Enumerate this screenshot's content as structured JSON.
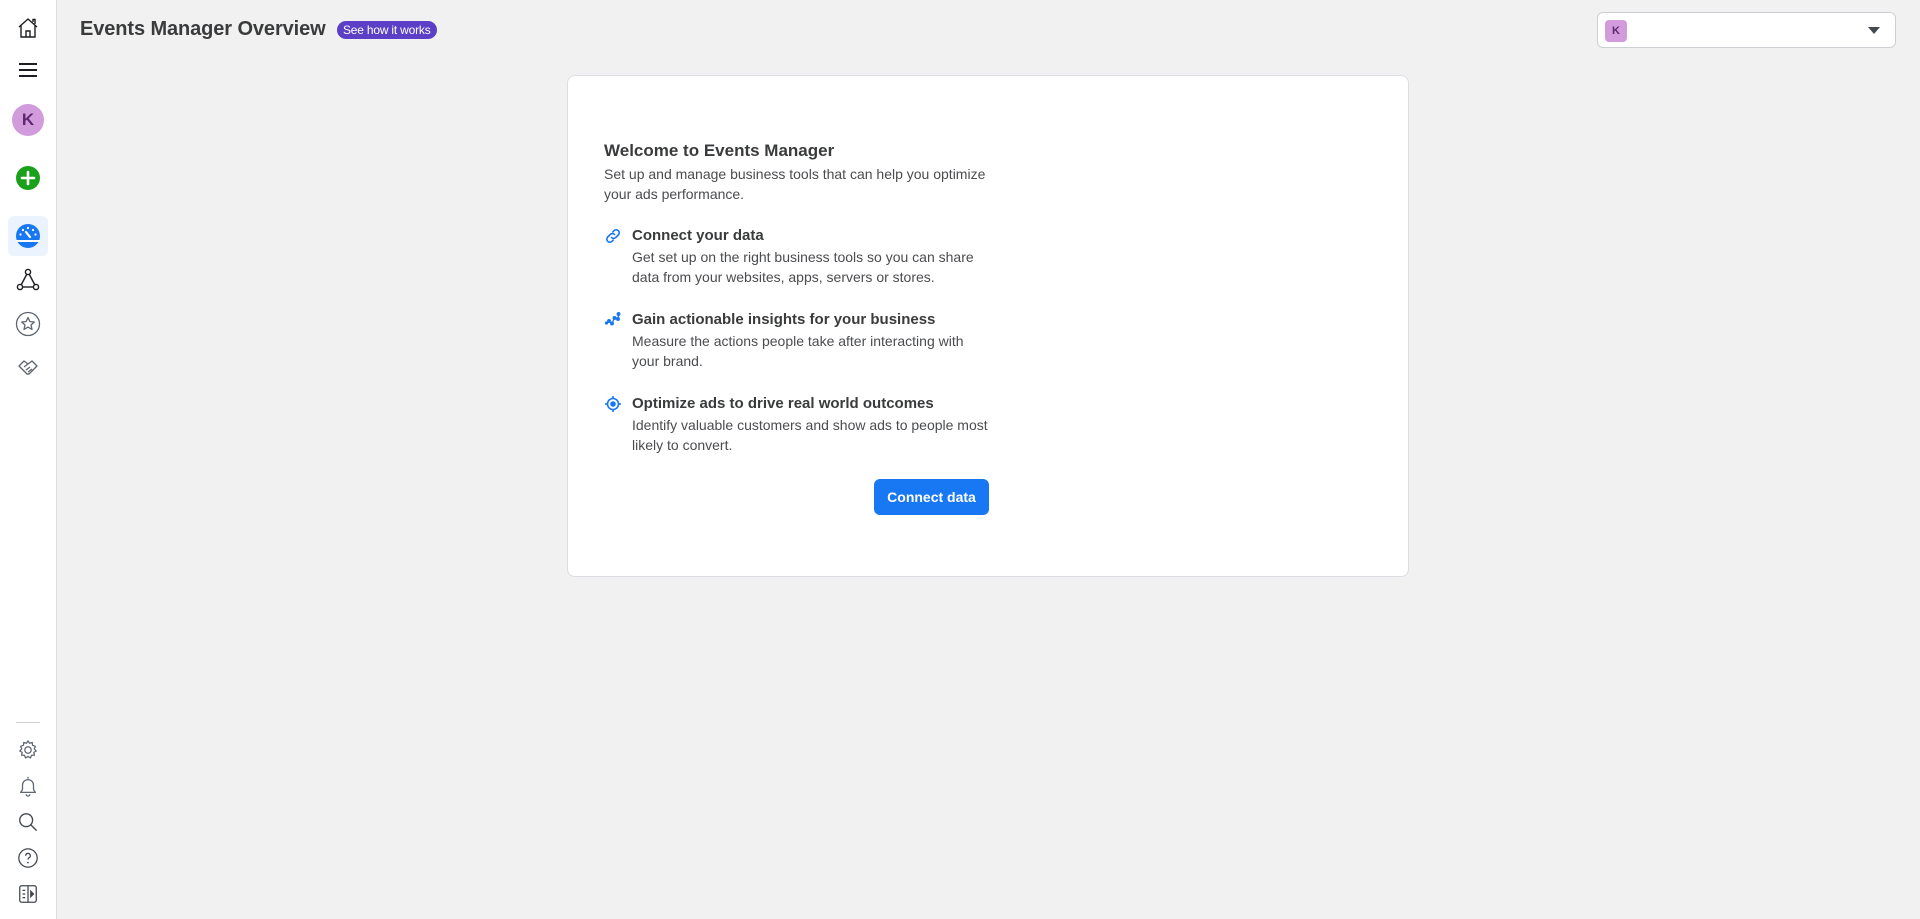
{
  "header": {
    "title": "Events Manager Overview",
    "see_how_label": "See how it works",
    "account_initial": "K"
  },
  "sidebar": {
    "items": [
      {
        "name": "home",
        "icon": "home-icon"
      },
      {
        "name": "menu",
        "icon": "hamburger-menu-icon"
      },
      {
        "name": "account",
        "icon": "avatar",
        "initial": "K"
      },
      {
        "name": "create",
        "icon": "plus-circle-icon"
      },
      {
        "name": "events-manager",
        "icon": "dashboard-gauge-icon",
        "active": true
      },
      {
        "name": "data-sources",
        "icon": "graph-nodes-icon"
      },
      {
        "name": "favorites",
        "icon": "star-circle-icon"
      },
      {
        "name": "partner-integrations",
        "icon": "handshake-icon"
      }
    ],
    "bottom_items": [
      {
        "name": "settings",
        "icon": "gear-icon"
      },
      {
        "name": "notifications",
        "icon": "bell-icon"
      },
      {
        "name": "search",
        "icon": "search-icon"
      },
      {
        "name": "help",
        "icon": "help-icon"
      },
      {
        "name": "toggle-panel",
        "icon": "panel-toggle-icon"
      }
    ]
  },
  "card": {
    "title": "Welcome to Events Manager",
    "subtitle": "Set up and manage business tools that can help you optimize your ads performance.",
    "features": [
      {
        "icon": "link-icon",
        "title": "Connect your data",
        "description": "Get set up on the right business tools so you can share data from your websites, apps, servers or stores."
      },
      {
        "icon": "insights-chart-icon",
        "title": "Gain actionable insights for your business",
        "description": "Measure the actions people take after interacting with your brand."
      },
      {
        "icon": "target-icon",
        "title": "Optimize ads to drive real world outcomes",
        "description": "Identify valuable customers and show ads to people most likely to convert."
      }
    ],
    "cta_label": "Connect data"
  },
  "colors": {
    "accent": "#1877f2",
    "badge_purple": "#5b3fc7",
    "avatar_pink": "#d19bdc",
    "create_green": "#1aa01a"
  }
}
